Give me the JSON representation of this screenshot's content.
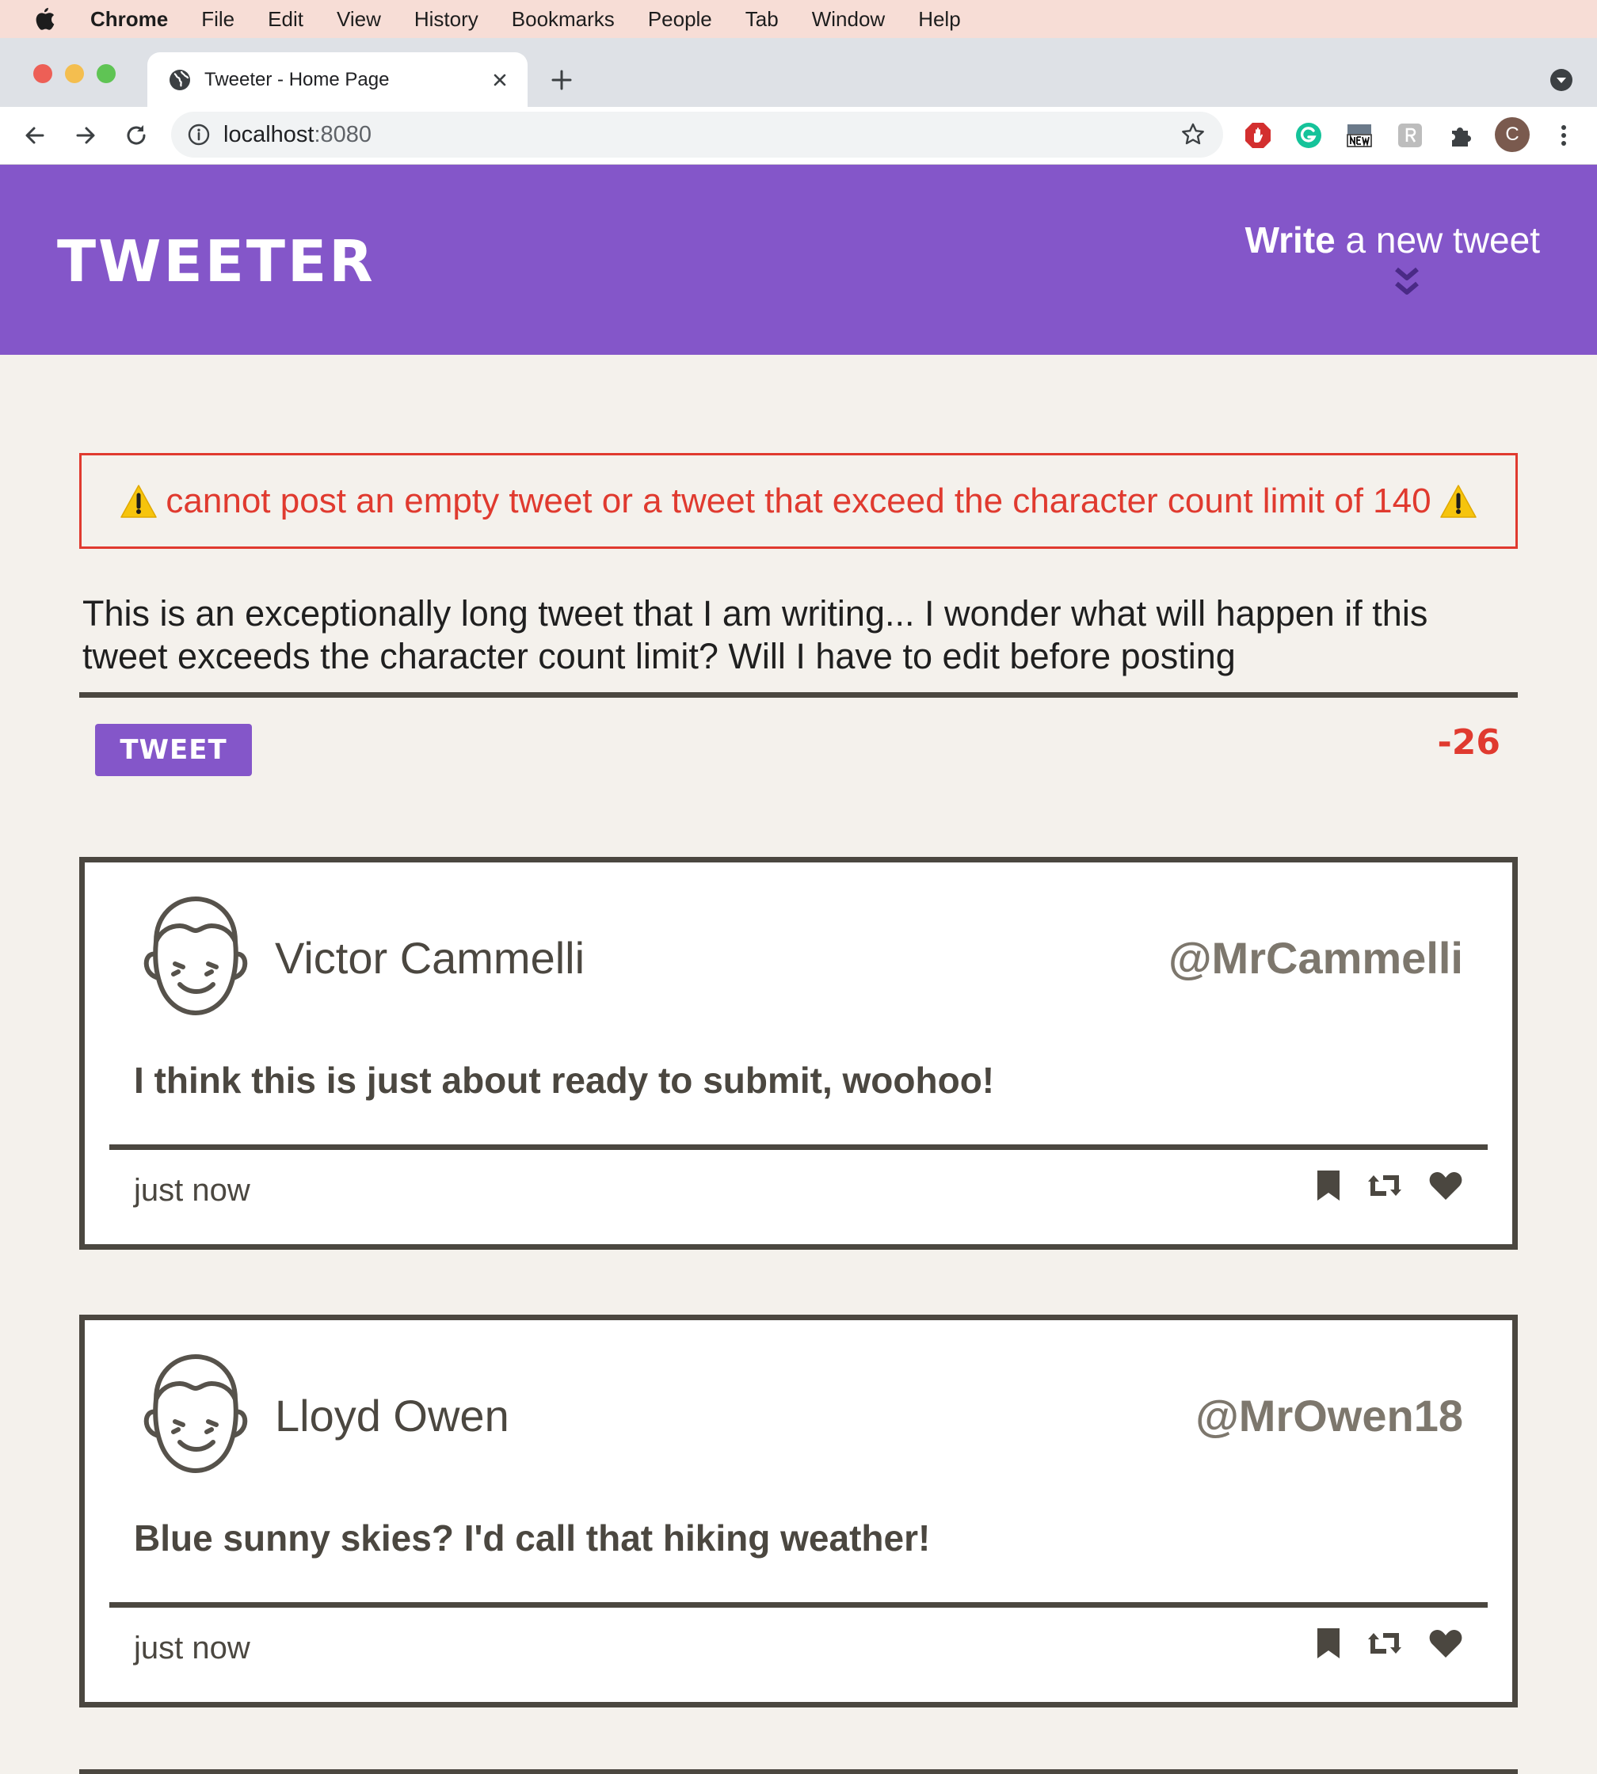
{
  "menubar": {
    "items": [
      "Chrome",
      "File",
      "Edit",
      "View",
      "History",
      "Bookmarks",
      "People",
      "Tab",
      "Window",
      "Help"
    ]
  },
  "browser": {
    "tab_title": "Tweeter - Home Page",
    "url_host": "localhost",
    "url_port": ":8080",
    "profile_initial": "C"
  },
  "app": {
    "logo": "TWEETER",
    "write_bold": "Write",
    "write_rest": " a new tweet",
    "error_message": "cannot post an empty tweet or a tweet that exceed the character count limit of 140",
    "compose_text": "This is an exceptionally long tweet that I am writing... I wonder what will happen if this tweet exceeds the character count limit? Will I have to edit before posting",
    "tweet_button": "TWEET",
    "counter": "-26"
  },
  "tweets": [
    {
      "name": "Victor Cammelli",
      "handle": "@MrCammelli",
      "content": "I think this is just about ready to submit, woohoo!",
      "time": "just now"
    },
    {
      "name": "Lloyd Owen",
      "handle": "@MrOwen18",
      "content": "Blue sunny skies? I'd call that hiking weather!",
      "time": "just now"
    }
  ],
  "colors": {
    "brand_purple": "#8456c9",
    "error_red": "#e03a2f",
    "dark_border": "#4b4740",
    "handle_gray": "#7d776d",
    "page_bg": "#f4f1ec"
  },
  "icons": [
    "apple-icon",
    "globe-icon",
    "close-icon",
    "plus-icon",
    "chevron-down-icon",
    "back-icon",
    "forward-icon",
    "reload-icon",
    "info-icon",
    "star-icon",
    "adblock-icon",
    "grammarly-icon",
    "news-icon",
    "extension-r-icon",
    "puzzle-icon",
    "more-icon",
    "double-chevron-down-icon",
    "warning-icon",
    "avatar-icon",
    "bookmark-icon",
    "retweet-icon",
    "heart-icon"
  ]
}
